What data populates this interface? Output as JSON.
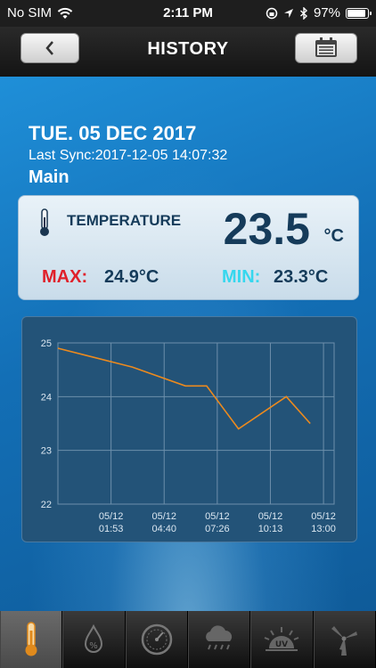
{
  "status_bar": {
    "carrier": "No SIM",
    "time": "2:11 PM",
    "battery_percent": "97%",
    "battery_level": 0.97
  },
  "nav": {
    "title": "HISTORY",
    "back_icon": "chevron-left-icon",
    "calendar_icon": "calendar-icon"
  },
  "header": {
    "date": "TUE. 05 DEC 2017",
    "last_sync": "Last Sync:2017-12-05 14:07:32",
    "device": "Main"
  },
  "reading": {
    "label": "TEMPERATURE",
    "value": "23.5",
    "unit": "°C",
    "max_label": "MAX:",
    "max_value": "24.9°C",
    "min_label": "MIN:",
    "min_value": "23.3°C",
    "max_color": "#e0202a",
    "min_color": "#36d7ee"
  },
  "chart_data": {
    "type": "line",
    "x_ticks": [
      "05/12\n01:53",
      "05/12\n04:40",
      "05/12\n07:26",
      "05/12\n10:13",
      "05/12\n13:00"
    ],
    "y_ticks": [
      "22",
      "23",
      "24",
      "25"
    ],
    "ylim": [
      22,
      25
    ],
    "xlim": [
      0,
      5.2
    ],
    "grid": true,
    "line_color": "#ec8a1e",
    "series": [
      {
        "x": [
          0,
          0.6,
          1.4,
          2.4,
          2.8,
          3.4,
          4.3,
          4.75
        ],
        "y": [
          24.9,
          24.75,
          24.55,
          24.2,
          24.2,
          23.4,
          24.0,
          23.5
        ]
      }
    ]
  },
  "tabs": [
    {
      "icon": "thermometer-icon",
      "active": true
    },
    {
      "icon": "humidity-icon",
      "active": false
    },
    {
      "icon": "barometer-icon",
      "active": false
    },
    {
      "icon": "rain-icon",
      "active": false
    },
    {
      "icon": "uv-icon",
      "label": "UV",
      "active": false
    },
    {
      "icon": "wind-icon",
      "active": false
    }
  ]
}
